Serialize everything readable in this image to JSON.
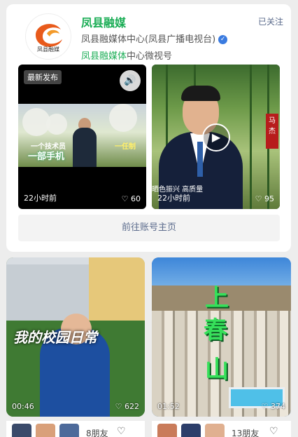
{
  "account": {
    "name": "凤县融媒",
    "follow_status": "已关注",
    "description": "凤县融媒体中心(凤县广播电视台)",
    "subtitle_highlight": "凤县融媒体",
    "subtitle_rest": "中心微视号",
    "logo_text": "凤县融媒"
  },
  "videos": [
    {
      "badge": "最新发布",
      "time": "22小时前",
      "likes": "60",
      "caption_top": "一个技术员",
      "caption_main": "一部手机",
      "caption_right": "一任制"
    },
    {
      "time": "22小时前",
      "likes": "95",
      "ticker": "晒色振兴 高质量",
      "name_tag": "马杰"
    }
  ],
  "goto_label": "前往账号主页",
  "feed": [
    {
      "title": "我的校园日常",
      "time": "00:46",
      "likes": "622",
      "friends": "8朋友"
    },
    {
      "title_chars": [
        "上",
        "春",
        "山"
      ],
      "time": "01:52",
      "likes": "374",
      "friends": "13朋友"
    }
  ],
  "colors": {
    "brand_green": "#1aad55",
    "link_blue": "#5b6b8c",
    "verify_blue": "#3a7be0"
  }
}
